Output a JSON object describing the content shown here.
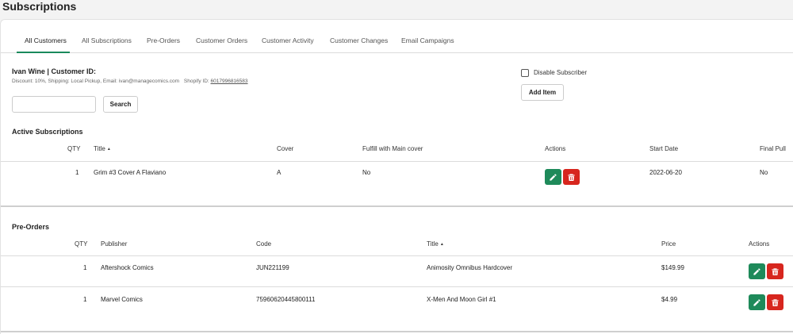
{
  "page": {
    "title": "Subscriptions"
  },
  "tabs": [
    {
      "label": "All Customers"
    },
    {
      "label": "All Subscriptions"
    },
    {
      "label": "Pre-Orders"
    },
    {
      "label": "Customer Orders"
    },
    {
      "label": "Customer Activity"
    },
    {
      "label": "Customer Changes"
    },
    {
      "label": "Email Campaigns"
    }
  ],
  "customer": {
    "heading": "Ivan Wine | Customer ID:",
    "meta": "Discount: 10%, Shipping: Local Pickup, Email: ivan@managecomics.com",
    "shopify_label": "Shopify ID:",
    "shopify_id": "6017996816583"
  },
  "search": {
    "placeholder": "",
    "button_label": "Search"
  },
  "disable_subscriber_label": "Disable Subscriber",
  "add_item_label": "Add Item",
  "active_subscriptions": {
    "title": "Active Subscriptions",
    "headers": {
      "qty": "QTY",
      "title": "Title",
      "cover": "Cover",
      "fulfill": "Fulfill with Main cover",
      "actions": "Actions",
      "start_date": "Start Date",
      "final_pull": "Final Pull"
    },
    "rows": [
      {
        "qty": "1",
        "title": "Grim #3 Cover A Flaviano",
        "cover": "A",
        "fulfill": "No",
        "start_date": "2022-06-20",
        "final_pull": "No"
      }
    ]
  },
  "pre_orders": {
    "title": "Pre-Orders",
    "headers": {
      "qty": "QTY",
      "publisher": "Publisher",
      "code": "Code",
      "title": "Title",
      "price": "Price",
      "actions": "Actions"
    },
    "rows": [
      {
        "qty": "1",
        "publisher": "Aftershock Comics",
        "code": "JUN221199",
        "title": "Animosity Omnibus Hardcover",
        "price": "$149.99"
      },
      {
        "qty": "1",
        "publisher": "Marvel Comics",
        "code": "75960620445800111",
        "title": "X-Men And Moon Girl #1",
        "price": "$4.99"
      }
    ]
  },
  "colors": {
    "accent": "#1a8a5c",
    "edit": "#1e8a5a",
    "delete": "#d7261e"
  }
}
